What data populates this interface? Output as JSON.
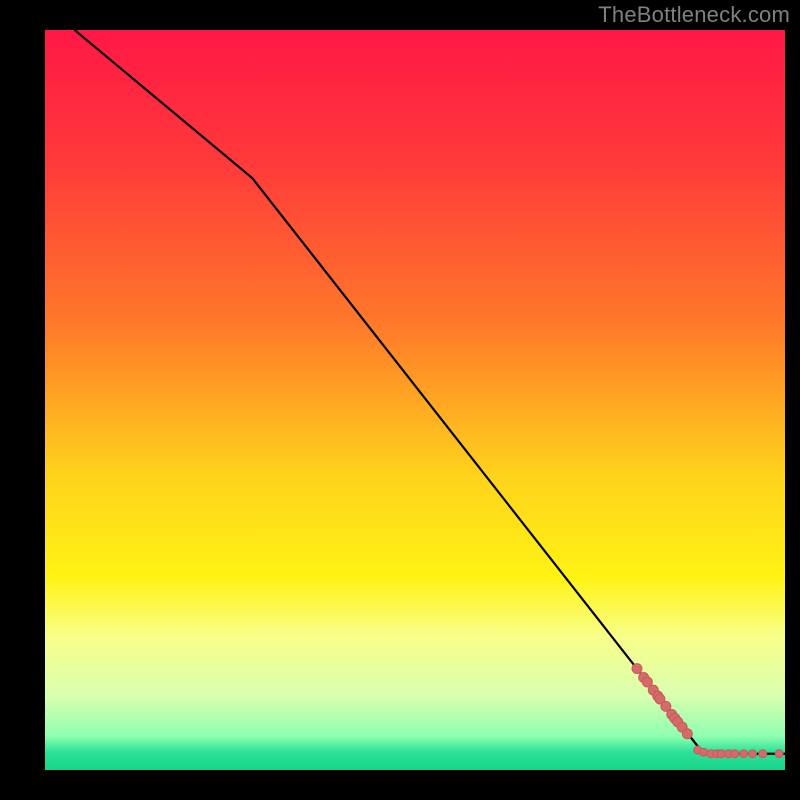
{
  "attribution": "TheBottleneck.com",
  "chart_data": {
    "type": "line",
    "title": "",
    "xlabel": "",
    "ylabel": "",
    "xlim": [
      0,
      100
    ],
    "ylim": [
      0,
      100
    ],
    "grid": false,
    "legend": false,
    "gradient": {
      "type": "vertical",
      "stops": [
        {
          "t": 0.0,
          "color": "#ff1846"
        },
        {
          "t": 0.18,
          "color": "#ff3a3a"
        },
        {
          "t": 0.4,
          "color": "#ff7a2a"
        },
        {
          "t": 0.6,
          "color": "#ffd21c"
        },
        {
          "t": 0.74,
          "color": "#fff314"
        },
        {
          "t": 0.82,
          "color": "#f8ff8a"
        },
        {
          "t": 0.9,
          "color": "#d9ffb0"
        },
        {
          "t": 0.955,
          "color": "#8dffb0"
        },
        {
          "t": 0.975,
          "color": "#2de29a"
        },
        {
          "t": 1.0,
          "color": "#17d488"
        }
      ]
    },
    "curve": [
      {
        "x": 4,
        "y": 100
      },
      {
        "x": 28,
        "y": 80
      },
      {
        "x": 89,
        "y": 2.2
      },
      {
        "x": 100,
        "y": 2.2
      }
    ],
    "scatter": {
      "color": "#d46a6a",
      "stroke": "#c95a5a",
      "r_small": 4,
      "r_big": 5,
      "points": [
        {
          "x": 80.0,
          "y": 13.7,
          "r": "big"
        },
        {
          "x": 80.9,
          "y": 12.5,
          "r": "big"
        },
        {
          "x": 81.4,
          "y": 11.9,
          "r": "big"
        },
        {
          "x": 82.2,
          "y": 10.8,
          "r": "big"
        },
        {
          "x": 82.8,
          "y": 10.0,
          "r": "big"
        },
        {
          "x": 83.1,
          "y": 9.6,
          "r": "big"
        },
        {
          "x": 83.9,
          "y": 8.6,
          "r": "big"
        },
        {
          "x": 84.7,
          "y": 7.5,
          "r": "big"
        },
        {
          "x": 85.1,
          "y": 7.0,
          "r": "big"
        },
        {
          "x": 85.5,
          "y": 6.5,
          "r": "big"
        },
        {
          "x": 86.1,
          "y": 5.8,
          "r": "big"
        },
        {
          "x": 86.8,
          "y": 4.9,
          "r": "big"
        },
        {
          "x": 88.2,
          "y": 2.7,
          "r": "small"
        },
        {
          "x": 89.0,
          "y": 2.4,
          "r": "small"
        },
        {
          "x": 90.0,
          "y": 2.2,
          "r": "small"
        },
        {
          "x": 90.8,
          "y": 2.2,
          "r": "small"
        },
        {
          "x": 91.4,
          "y": 2.2,
          "r": "small"
        },
        {
          "x": 92.4,
          "y": 2.2,
          "r": "small"
        },
        {
          "x": 93.2,
          "y": 2.2,
          "r": "small"
        },
        {
          "x": 94.4,
          "y": 2.2,
          "r": "small"
        },
        {
          "x": 95.6,
          "y": 2.2,
          "r": "small"
        },
        {
          "x": 97.0,
          "y": 2.2,
          "r": "small"
        },
        {
          "x": 99.2,
          "y": 2.2,
          "r": "small"
        }
      ]
    }
  }
}
